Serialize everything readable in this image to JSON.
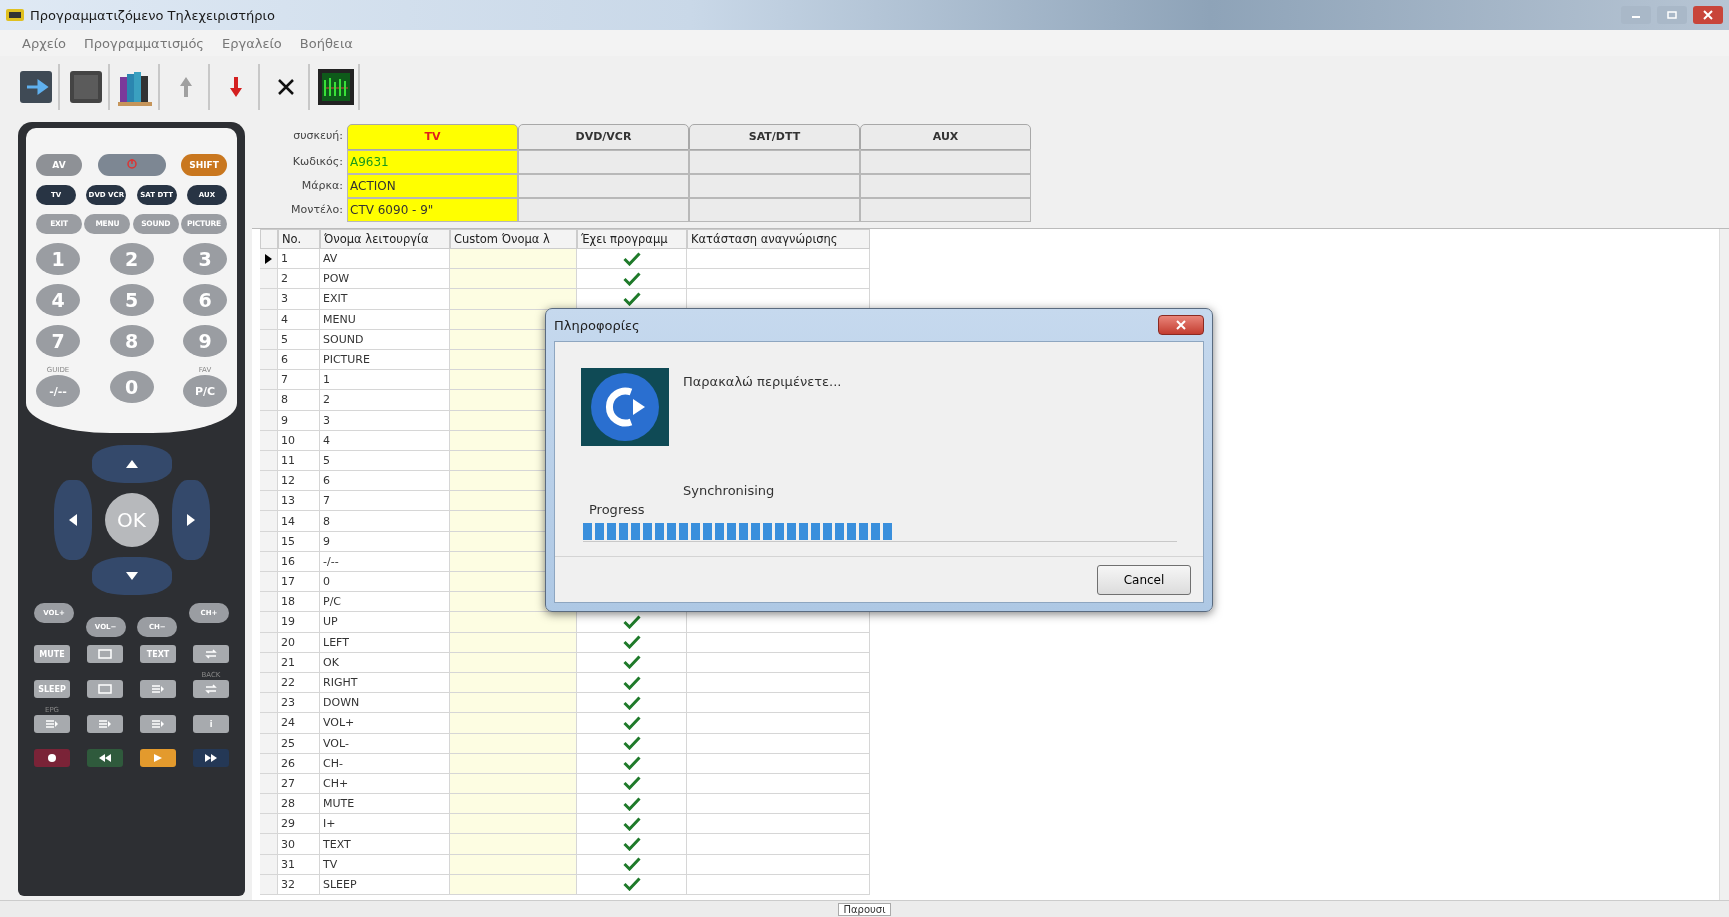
{
  "window": {
    "title": "Προγραμματιζόμενο Τηλεχειριστήριο"
  },
  "menu": [
    "Αρχείο",
    "Προγραμματισμός",
    "Εργαλείο",
    "Βοήθεια"
  ],
  "toolbar": [
    {
      "kind": "send"
    },
    {
      "kind": "blank"
    },
    {
      "kind": "books"
    },
    {
      "kind": "up"
    },
    {
      "kind": "down"
    },
    {
      "kind": "delete"
    },
    {
      "kind": "signal"
    }
  ],
  "remote": {
    "top_row": [
      {
        "kind": "pill",
        "label": "AV",
        "color": "#8e9196"
      },
      {
        "kind": "power",
        "color": "#7d8793"
      },
      {
        "kind": "pill",
        "label": "SHIFT",
        "color": "#c9771f"
      }
    ],
    "source_row": [
      "TV",
      "DVD VCR",
      "SAT DTT",
      "AUX"
    ],
    "menu_row": [
      "EXIT",
      "MENU",
      "SOUND",
      "PICTURE"
    ],
    "digits": [
      "1",
      "2",
      "3",
      "4",
      "5",
      "6",
      "7",
      "8",
      "9"
    ],
    "last_row": [
      {
        "label": "-/--",
        "caption": "GUIDE"
      },
      {
        "label": "0"
      },
      {
        "label": "P/C",
        "caption": "FAV"
      }
    ],
    "ok": "OK",
    "volume_row": [
      "VOL+",
      "VOL−",
      "CH−",
      "CH+"
    ],
    "function_rows": [
      [
        {
          "label": "MUTE"
        },
        {
          "kind": "screen"
        },
        {
          "label": "TEXT"
        },
        {
          "kind": "swap"
        }
      ],
      [
        {
          "label": "SLEEP"
        },
        {
          "kind": "screen"
        },
        {
          "kind": "list"
        },
        {
          "kind": "swap",
          "caption": "BACK"
        }
      ],
      [
        {
          "kind": "list",
          "caption": "EPG"
        },
        {
          "kind": "list"
        },
        {
          "kind": "list"
        },
        {
          "label": "i"
        }
      ]
    ],
    "media_row": [
      {
        "kind": "record",
        "color": "#7a2337"
      },
      {
        "kind": "rewind",
        "color": "#2f5a3c"
      },
      {
        "kind": "play",
        "color": "#e39a2d"
      },
      {
        "kind": "forward",
        "color": "#243856"
      }
    ]
  },
  "device": {
    "labels": [
      "συσκευή:",
      "Κωδικός:",
      "Μάρκα:",
      "Μοντέλο:"
    ],
    "columns": [
      {
        "name": "TV",
        "selected": true,
        "code": "A9631",
        "brand": "ACTION",
        "model": "CTV 6090 - 9\""
      },
      {
        "name": "DVD/VCR",
        "selected": false
      },
      {
        "name": "SAT/DTT",
        "selected": false
      },
      {
        "name": "AUX",
        "selected": false
      }
    ]
  },
  "table": {
    "columns": [
      "No.",
      "Όνομα λειτουργία",
      "Custom Όνομα λ",
      "Έχει προγραμμ",
      "Κατάσταση αναγνώρισης"
    ],
    "rows": [
      {
        "no": "1",
        "name": "AV",
        "programmed": true,
        "selected": true
      },
      {
        "no": "2",
        "name": "POW",
        "programmed": true,
        "selected": false
      },
      {
        "no": "3",
        "name": "EXIT",
        "programmed": true,
        "selected": false
      },
      {
        "no": "4",
        "name": "MENU",
        "selected": false
      },
      {
        "no": "5",
        "name": "SOUND",
        "selected": false
      },
      {
        "no": "6",
        "name": "PICTURE",
        "selected": false
      },
      {
        "no": "7",
        "name": "1",
        "selected": false
      },
      {
        "no": "8",
        "name": "2",
        "selected": false
      },
      {
        "no": "9",
        "name": "3",
        "selected": false
      },
      {
        "no": "10",
        "name": "4",
        "selected": false
      },
      {
        "no": "11",
        "name": "5",
        "selected": false
      },
      {
        "no": "12",
        "name": "6",
        "selected": false
      },
      {
        "no": "13",
        "name": "7",
        "selected": false
      },
      {
        "no": "14",
        "name": "8",
        "selected": false
      },
      {
        "no": "15",
        "name": "9",
        "selected": false
      },
      {
        "no": "16",
        "name": "-/--",
        "selected": false
      },
      {
        "no": "17",
        "name": "0",
        "selected": false
      },
      {
        "no": "18",
        "name": "P/C",
        "selected": false
      },
      {
        "no": "19",
        "name": "UP",
        "programmed": true,
        "selected": false
      },
      {
        "no": "20",
        "name": "LEFT",
        "programmed": true,
        "selected": false
      },
      {
        "no": "21",
        "name": "OK",
        "programmed": true,
        "selected": false
      },
      {
        "no": "22",
        "name": "RIGHT",
        "programmed": true,
        "selected": false
      },
      {
        "no": "23",
        "name": "DOWN",
        "programmed": true,
        "selected": false
      },
      {
        "no": "24",
        "name": "VOL+",
        "programmed": true,
        "selected": false
      },
      {
        "no": "25",
        "name": "VOL-",
        "programmed": true,
        "selected": false
      },
      {
        "no": "26",
        "name": "CH-",
        "programmed": true,
        "selected": false
      },
      {
        "no": "27",
        "name": "CH+",
        "programmed": true,
        "selected": false
      },
      {
        "no": "28",
        "name": "MUTE",
        "programmed": true,
        "selected": false
      },
      {
        "no": "29",
        "name": "I+",
        "programmed": true,
        "selected": false
      },
      {
        "no": "30",
        "name": "TEXT",
        "programmed": true,
        "selected": false
      },
      {
        "no": "31",
        "name": "TV",
        "programmed": true,
        "selected": false
      },
      {
        "no": "32",
        "name": "SLEEP",
        "programmed": true,
        "selected": false
      }
    ]
  },
  "dialog": {
    "title": "Πληροφορίες",
    "message": "Παρακαλώ περιμένετε...",
    "status": "Synchronising",
    "progress_label": "Progress",
    "level": 0.52,
    "button": "Cancel"
  },
  "status_bar": {
    "text": "Παρουσι"
  }
}
